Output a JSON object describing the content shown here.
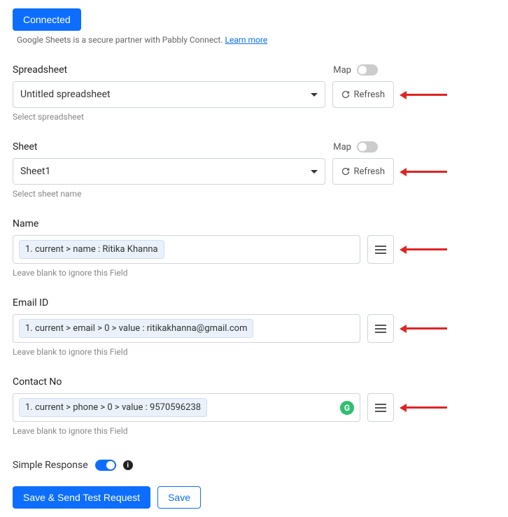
{
  "connected_label": "Connected",
  "secure_text": "Google Sheets is a secure partner with Pabbly Connect. ",
  "learn_more": "Learn more",
  "map_label": "Map",
  "refresh_label": "Refresh",
  "spreadsheet": {
    "label": "Spreadsheet",
    "value": "Untitled spreadsheet",
    "helper": "Select spreadsheet"
  },
  "sheet": {
    "label": "Sheet",
    "value": "Sheet1",
    "helper": "Select sheet name"
  },
  "name_field": {
    "label": "Name",
    "token": "1. current > name : Ritika Khanna",
    "helper": "Leave blank to ignore this Field"
  },
  "email_field": {
    "label": "Email ID",
    "token": "1. current > email > 0 > value : ritikakhanna@gmail.com",
    "helper": "Leave blank to ignore this Field"
  },
  "contact_field": {
    "label": "Contact No",
    "token": "1. current > phone > 0 > value : 9570596238",
    "helper": "Leave blank to ignore this Field",
    "g_badge": "G"
  },
  "simple_response_label": "Simple Response",
  "save_send_label": "Save & Send Test Request",
  "save_label": "Save"
}
